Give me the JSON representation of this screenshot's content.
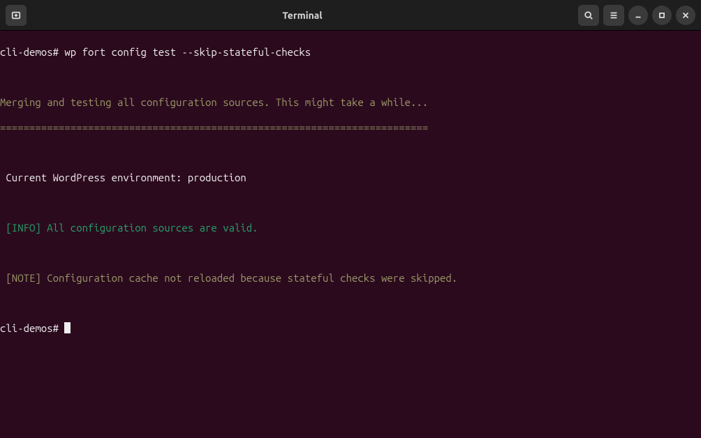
{
  "window": {
    "title": "Terminal"
  },
  "terminal": {
    "prompt1": "cli-demos# ",
    "command1": "wp fort config test --skip-stateful-checks",
    "merging": "Merging and testing all configuration sources. This might take a while...",
    "divider": "=========================================================================",
    "env": " Current WordPress environment: production",
    "info": " [INFO] All configuration sources are valid.",
    "note": " [NOTE] Configuration cache not reloaded because stateful checks were skipped.",
    "prompt2": "cli-demos# "
  }
}
